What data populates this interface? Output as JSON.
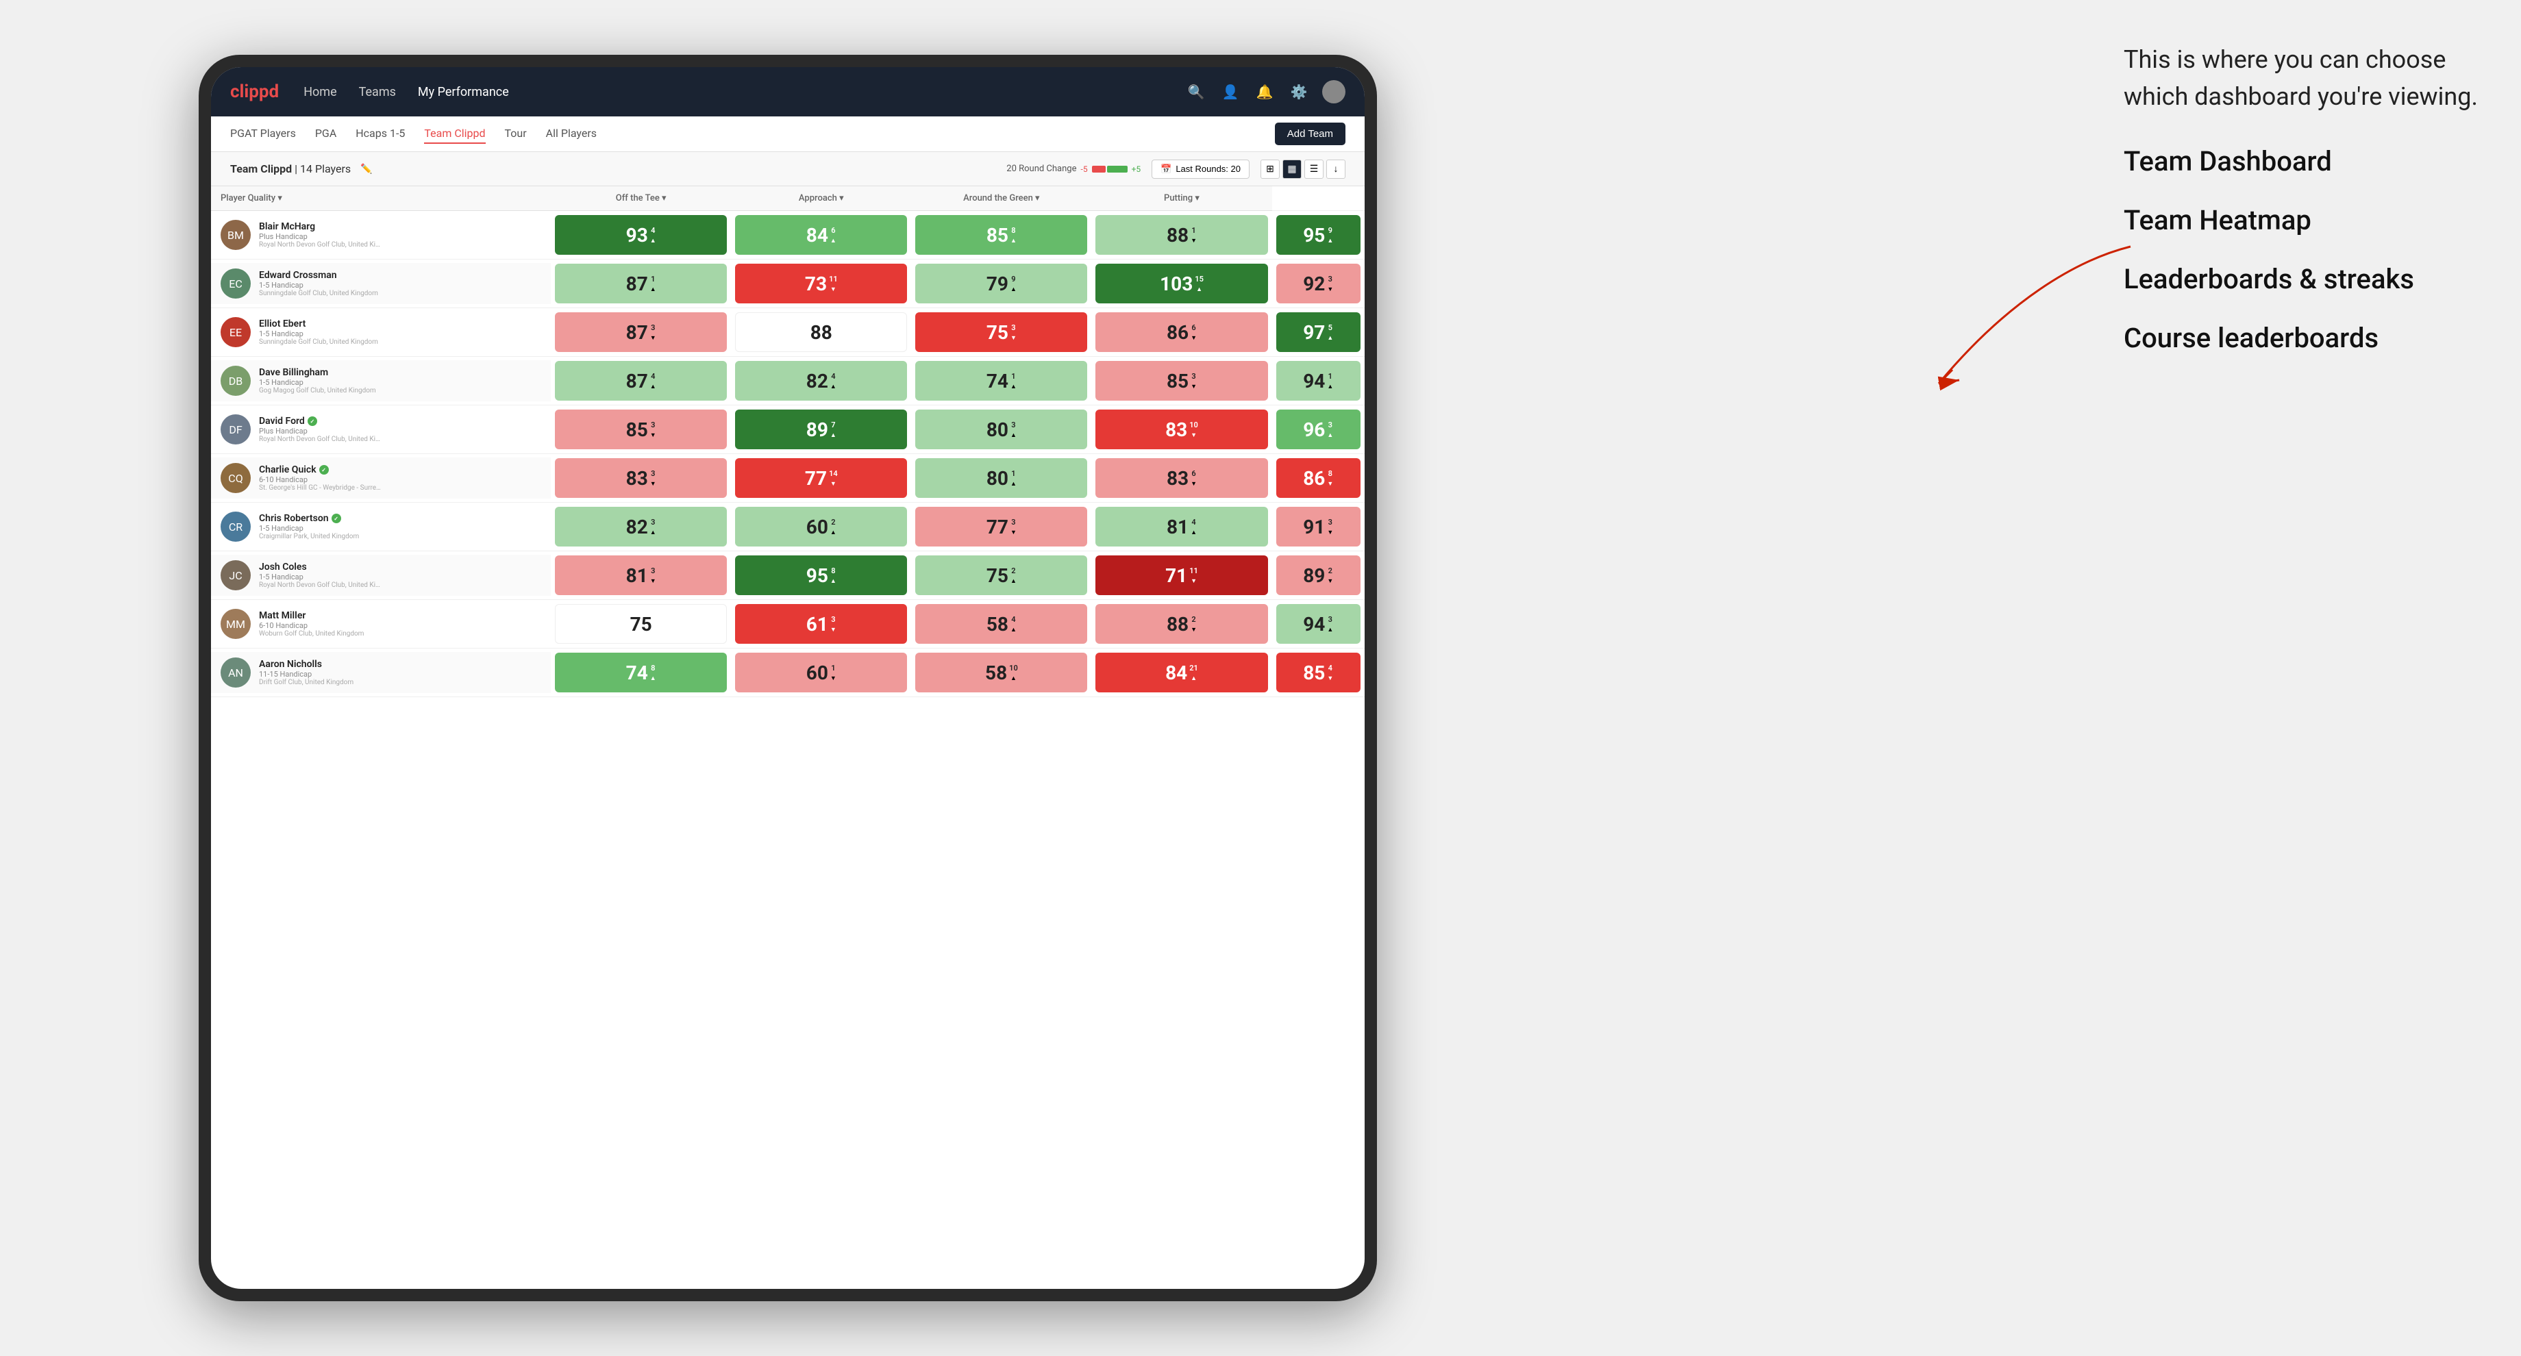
{
  "annotation": {
    "intro": "This is where you can choose which dashboard you're viewing.",
    "options": [
      "Team Dashboard",
      "Team Heatmap",
      "Leaderboards & streaks",
      "Course leaderboards"
    ]
  },
  "nav": {
    "logo": "clippd",
    "links": [
      "Home",
      "Teams",
      "My Performance"
    ],
    "active_link": "My Performance"
  },
  "sub_nav": {
    "links": [
      "PGAT Players",
      "PGA",
      "Hcaps 1-5",
      "Team Clippd",
      "Tour",
      "All Players"
    ],
    "active": "Team Clippd",
    "add_team_label": "Add Team"
  },
  "team_header": {
    "title": "Team Clippd",
    "separator": "|",
    "count": "14 Players",
    "round_change_label": "20 Round Change",
    "neg_label": "-5",
    "pos_label": "+5",
    "last_rounds_label": "Last Rounds: 20"
  },
  "table": {
    "columns": [
      "Player Quality ▾",
      "Off the Tee ▾",
      "Approach ▾",
      "Around the Green ▾",
      "Putting ▾"
    ],
    "rows": [
      {
        "name": "Blair McHarg",
        "handicap": "Plus Handicap",
        "club": "Royal North Devon Golf Club, United Kingdom",
        "avatar_color": "#8d6748",
        "initials": "BM",
        "verified": false,
        "scores": [
          {
            "value": 93,
            "change": 4,
            "dir": "up",
            "bg": "bg-green-dark"
          },
          {
            "value": 84,
            "change": 6,
            "dir": "up",
            "bg": "bg-green-medium"
          },
          {
            "value": 85,
            "change": 8,
            "dir": "up",
            "bg": "bg-green-medium"
          },
          {
            "value": 88,
            "change": 1,
            "dir": "down",
            "bg": "bg-green-light"
          },
          {
            "value": 95,
            "change": 9,
            "dir": "up",
            "bg": "bg-green-dark"
          }
        ]
      },
      {
        "name": "Edward Crossman",
        "handicap": "1-5 Handicap",
        "club": "Sunningdale Golf Club, United Kingdom",
        "avatar_color": "#5a8a6a",
        "initials": "EC",
        "verified": false,
        "scores": [
          {
            "value": 87,
            "change": 1,
            "dir": "up",
            "bg": "bg-green-light"
          },
          {
            "value": 73,
            "change": 11,
            "dir": "down",
            "bg": "bg-red-medium"
          },
          {
            "value": 79,
            "change": 9,
            "dir": "up",
            "bg": "bg-green-light"
          },
          {
            "value": 103,
            "change": 15,
            "dir": "up",
            "bg": "bg-green-dark"
          },
          {
            "value": 92,
            "change": 3,
            "dir": "down",
            "bg": "bg-red-light"
          }
        ]
      },
      {
        "name": "Elliot Ebert",
        "handicap": "1-5 Handicap",
        "club": "Sunningdale Golf Club, United Kingdom",
        "avatar_color": "#c0392b",
        "initials": "EE",
        "verified": false,
        "scores": [
          {
            "value": 87,
            "change": 3,
            "dir": "down",
            "bg": "bg-red-light"
          },
          {
            "value": 88,
            "change": null,
            "dir": null,
            "bg": "bg-white"
          },
          {
            "value": 75,
            "change": 3,
            "dir": "down",
            "bg": "bg-red-medium"
          },
          {
            "value": 86,
            "change": 6,
            "dir": "down",
            "bg": "bg-red-light"
          },
          {
            "value": 97,
            "change": 5,
            "dir": "up",
            "bg": "bg-green-dark"
          }
        ]
      },
      {
        "name": "Dave Billingham",
        "handicap": "1-5 Handicap",
        "club": "Gog Magog Golf Club, United Kingdom",
        "avatar_color": "#7b9e6b",
        "initials": "DB",
        "verified": false,
        "scores": [
          {
            "value": 87,
            "change": 4,
            "dir": "up",
            "bg": "bg-green-light"
          },
          {
            "value": 82,
            "change": 4,
            "dir": "up",
            "bg": "bg-green-light"
          },
          {
            "value": 74,
            "change": 1,
            "dir": "up",
            "bg": "bg-green-light"
          },
          {
            "value": 85,
            "change": 3,
            "dir": "down",
            "bg": "bg-red-light"
          },
          {
            "value": 94,
            "change": 1,
            "dir": "up",
            "bg": "bg-green-light"
          }
        ]
      },
      {
        "name": "David Ford",
        "handicap": "Plus Handicap",
        "club": "Royal North Devon Golf Club, United Kingdom",
        "avatar_color": "#6d7b8d",
        "initials": "DF",
        "verified": true,
        "scores": [
          {
            "value": 85,
            "change": 3,
            "dir": "down",
            "bg": "bg-red-light"
          },
          {
            "value": 89,
            "change": 7,
            "dir": "up",
            "bg": "bg-green-dark"
          },
          {
            "value": 80,
            "change": 3,
            "dir": "up",
            "bg": "bg-green-light"
          },
          {
            "value": 83,
            "change": 10,
            "dir": "down",
            "bg": "bg-red-medium"
          },
          {
            "value": 96,
            "change": 3,
            "dir": "up",
            "bg": "bg-green-medium"
          }
        ]
      },
      {
        "name": "Charlie Quick",
        "handicap": "6-10 Handicap",
        "club": "St. George's Hill GC - Weybridge - Surrey, Uni...",
        "avatar_color": "#8e6b3e",
        "initials": "CQ",
        "verified": true,
        "scores": [
          {
            "value": 83,
            "change": 3,
            "dir": "down",
            "bg": "bg-red-light"
          },
          {
            "value": 77,
            "change": 14,
            "dir": "down",
            "bg": "bg-red-medium"
          },
          {
            "value": 80,
            "change": 1,
            "dir": "up",
            "bg": "bg-green-light"
          },
          {
            "value": 83,
            "change": 6,
            "dir": "down",
            "bg": "bg-red-light"
          },
          {
            "value": 86,
            "change": 8,
            "dir": "down",
            "bg": "bg-red-medium"
          }
        ]
      },
      {
        "name": "Chris Robertson",
        "handicap": "1-5 Handicap",
        "club": "Craigmillar Park, United Kingdom",
        "avatar_color": "#4a7a9b",
        "initials": "CR",
        "verified": true,
        "scores": [
          {
            "value": 82,
            "change": 3,
            "dir": "up",
            "bg": "bg-green-light"
          },
          {
            "value": 60,
            "change": 2,
            "dir": "up",
            "bg": "bg-green-light"
          },
          {
            "value": 77,
            "change": 3,
            "dir": "down",
            "bg": "bg-red-light"
          },
          {
            "value": 81,
            "change": 4,
            "dir": "up",
            "bg": "bg-green-light"
          },
          {
            "value": 91,
            "change": 3,
            "dir": "down",
            "bg": "bg-red-light"
          }
        ]
      },
      {
        "name": "Josh Coles",
        "handicap": "1-5 Handicap",
        "club": "Royal North Devon Golf Club, United Kingdom",
        "avatar_color": "#7a6b5a",
        "initials": "JC",
        "verified": false,
        "scores": [
          {
            "value": 81,
            "change": 3,
            "dir": "down",
            "bg": "bg-red-light"
          },
          {
            "value": 95,
            "change": 8,
            "dir": "up",
            "bg": "bg-green-dark"
          },
          {
            "value": 75,
            "change": 2,
            "dir": "up",
            "bg": "bg-green-light"
          },
          {
            "value": 71,
            "change": 11,
            "dir": "down",
            "bg": "bg-red-dark"
          },
          {
            "value": 89,
            "change": 2,
            "dir": "down",
            "bg": "bg-red-light"
          }
        ]
      },
      {
        "name": "Matt Miller",
        "handicap": "6-10 Handicap",
        "club": "Woburn Golf Club, United Kingdom",
        "avatar_color": "#9e7b5a",
        "initials": "MM",
        "verified": false,
        "scores": [
          {
            "value": 75,
            "change": null,
            "dir": null,
            "bg": "bg-white"
          },
          {
            "value": 61,
            "change": 3,
            "dir": "down",
            "bg": "bg-red-medium"
          },
          {
            "value": 58,
            "change": 4,
            "dir": "up",
            "bg": "bg-red-light"
          },
          {
            "value": 88,
            "change": 2,
            "dir": "down",
            "bg": "bg-red-light"
          },
          {
            "value": 94,
            "change": 3,
            "dir": "up",
            "bg": "bg-green-light"
          }
        ]
      },
      {
        "name": "Aaron Nicholls",
        "handicap": "11-15 Handicap",
        "club": "Drift Golf Club, United Kingdom",
        "avatar_color": "#6b8b7a",
        "initials": "AN",
        "verified": false,
        "scores": [
          {
            "value": 74,
            "change": 8,
            "dir": "up",
            "bg": "bg-green-medium"
          },
          {
            "value": 60,
            "change": 1,
            "dir": "down",
            "bg": "bg-red-light"
          },
          {
            "value": 58,
            "change": 10,
            "dir": "up",
            "bg": "bg-red-light"
          },
          {
            "value": 84,
            "change": 21,
            "dir": "up",
            "bg": "bg-red-medium"
          },
          {
            "value": 85,
            "change": 4,
            "dir": "down",
            "bg": "bg-red-medium"
          }
        ]
      }
    ]
  }
}
